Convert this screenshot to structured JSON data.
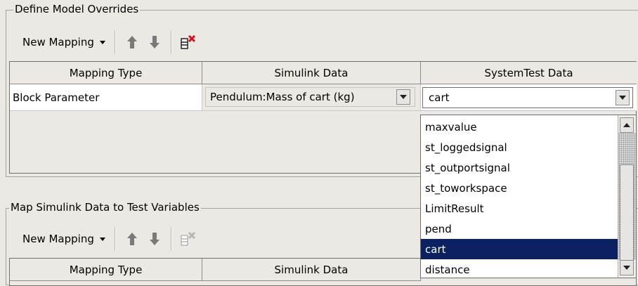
{
  "define_overrides": {
    "title": "Define Model Overrides",
    "toolbar": {
      "new_mapping_label": "New Mapping"
    },
    "columns": [
      "Mapping Type",
      "Simulink Data",
      "SystemTest Data"
    ],
    "row": {
      "mapping_type": "Block Parameter",
      "simulink_data": "Pendulum:Mass of cart (kg)",
      "systemtest_data": "cart"
    }
  },
  "dropdown": {
    "options": [
      "maxvalue",
      "st_loggedsignal",
      "st_outportsignal",
      "st_toworkspace",
      "LimitResult",
      "pend",
      "cart",
      "distance"
    ],
    "selected": "cart"
  },
  "map_simulink": {
    "title": "Map Simulink Data to Test Variables",
    "toolbar": {
      "new_mapping_label": "New Mapping"
    },
    "columns": [
      "Mapping Type",
      "Simulink Data"
    ]
  },
  "colors": {
    "background": "#ece9e4",
    "selection": "#0b2161",
    "arrow_enabled": "#7a7a7a",
    "arrow_disabled": "#b5b5b5",
    "delete_x": "#d6101b"
  },
  "icons": [
    "caret-down-icon",
    "arrow-up-icon",
    "arrow-down-icon",
    "delete-row-icon",
    "dropdown-arrow-icon"
  ]
}
